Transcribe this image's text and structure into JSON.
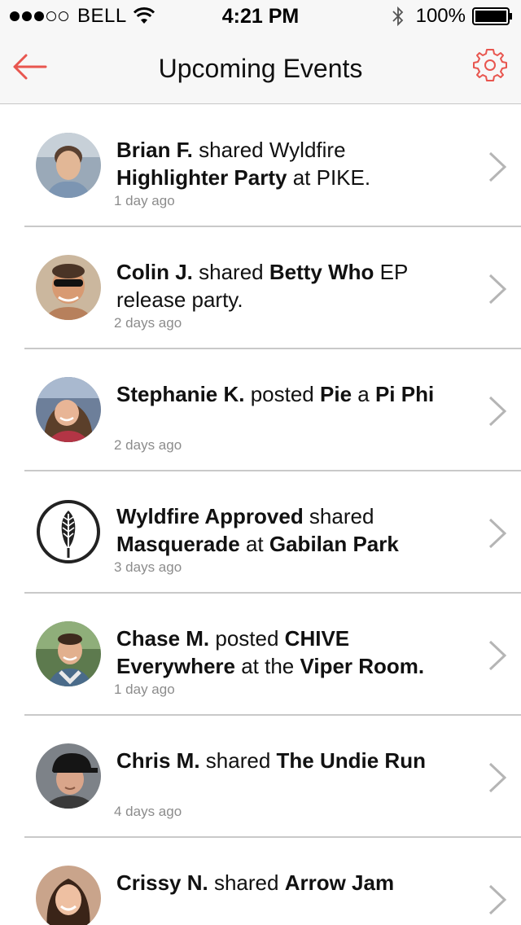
{
  "status_bar": {
    "carrier": "BELL",
    "time": "4:21 PM",
    "battery": "100%",
    "signal_bars_filled": 3,
    "signal_bars_total": 5
  },
  "nav": {
    "title": "Upcoming Events",
    "back_icon": "back-arrow-icon",
    "settings_icon": "gear-icon",
    "accent_color": "#e8564f"
  },
  "feed": [
    {
      "segments": [
        {
          "text": "Brian F.",
          "bold": true
        },
        {
          "text": " shared Wyldfire ",
          "bold": false
        },
        {
          "text": "Highlighter Party",
          "bold": true
        },
        {
          "text": " at PIKE.",
          "bold": false
        }
      ],
      "time": "1 day ago",
      "avatar": "photo-man-brown-hair"
    },
    {
      "segments": [
        {
          "text": "Colin J.",
          "bold": true
        },
        {
          "text": " shared ",
          "bold": false
        },
        {
          "text": "Betty Who",
          "bold": true
        },
        {
          "text": " EP release party.",
          "bold": false
        }
      ],
      "time": "2 days ago",
      "avatar": "photo-man-sunglasses"
    },
    {
      "segments": [
        {
          "text": "Stephanie K.",
          "bold": true
        },
        {
          "text": " posted ",
          "bold": false
        },
        {
          "text": "Pie",
          "bold": true
        },
        {
          "text": " a ",
          "bold": false
        },
        {
          "text": "Pi Phi",
          "bold": true
        }
      ],
      "time": "2 days ago",
      "avatar": "photo-woman-smiling"
    },
    {
      "segments": [
        {
          "text": "Wyldfire Approved",
          "bold": true
        },
        {
          "text": " shared ",
          "bold": false
        },
        {
          "text": "Masquerade",
          "bold": true
        },
        {
          "text": " at ",
          "bold": false
        },
        {
          "text": "Gabilan Park",
          "bold": true
        }
      ],
      "time": "3 days ago",
      "avatar": "feather-logo-icon"
    },
    {
      "segments": [
        {
          "text": "Chase M.",
          "bold": true
        },
        {
          "text": " posted ",
          "bold": false
        },
        {
          "text": "CHIVE Everywhere",
          "bold": true
        },
        {
          "text": " at the ",
          "bold": false
        },
        {
          "text": "Viper Room.",
          "bold": true
        }
      ],
      "time": "1 day ago",
      "avatar": "photo-man-outdoors"
    },
    {
      "segments": [
        {
          "text": "Chris M.",
          "bold": true
        },
        {
          "text": " shared ",
          "bold": false
        },
        {
          "text": "The Undie Run",
          "bold": true
        }
      ],
      "time": "4 days ago",
      "avatar": "photo-man-cap"
    },
    {
      "segments": [
        {
          "text": "Crissy N.",
          "bold": true
        },
        {
          "text": " shared ",
          "bold": false
        },
        {
          "text": "Arrow Jam",
          "bold": true
        }
      ],
      "time": "",
      "avatar": "photo-woman-dark-hair"
    }
  ]
}
